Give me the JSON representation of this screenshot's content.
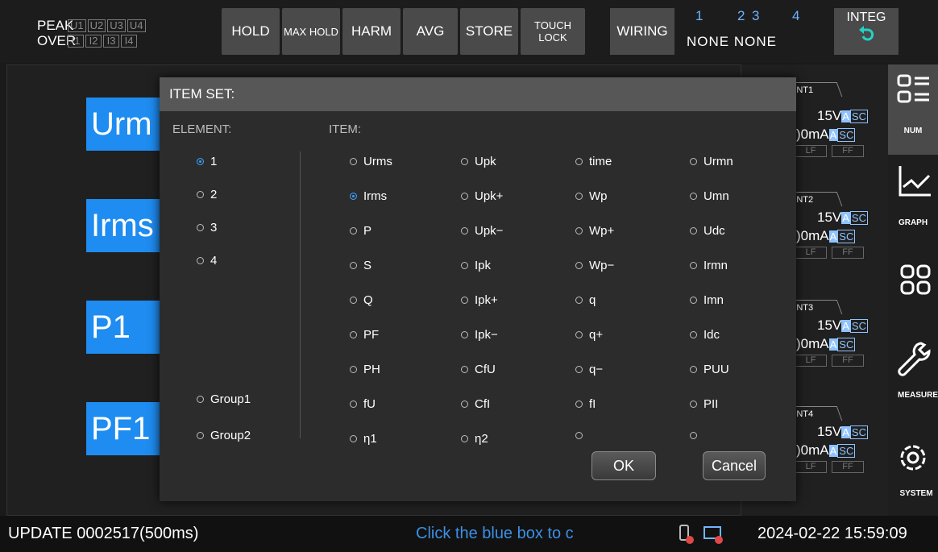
{
  "topbar": {
    "peak_label": "PEAK",
    "over_label": "OVER",
    "peak_chips": [
      "U1",
      "U2",
      "U3",
      "U4"
    ],
    "over_chips": [
      "I1",
      "I2",
      "I3",
      "I4"
    ],
    "hold": "HOLD",
    "max_hold": "MAX HOLD",
    "harm": "HARM",
    "avg": "AVG",
    "store": "STORE",
    "touch_lock": "TOUCH LOCK",
    "wiring": "WIRING",
    "wiring_nums": [
      "1",
      "2",
      "3",
      "4"
    ],
    "wiring_vals": "NONE NONE",
    "integ": "INTEG",
    "integ_icon": "reset-arrow-icon"
  },
  "main": {
    "boxes": [
      "Urm",
      "Irms",
      "P1",
      "PF1"
    ]
  },
  "elements": [
    {
      "tab": "NT1",
      "range_v": "15V",
      "range_i": ")0mA",
      "lf": "LF",
      "ff": "FF",
      "a": "A",
      "sc": "SC"
    },
    {
      "tab": "NT2",
      "range_v": "15V",
      "range_i": ")0mA",
      "lf": "LF",
      "ff": "FF",
      "a": "A",
      "sc": "SC"
    },
    {
      "tab": "NT3",
      "range_v": "15V",
      "range_i": ")0mA",
      "lf": "LF",
      "ff": "FF",
      "a": "A",
      "sc": "SC"
    },
    {
      "tab": "NT4",
      "range_v": "15V",
      "range_i": ")0mA",
      "lf": "LF",
      "ff": "FF",
      "a": "A",
      "sc": "SC"
    }
  ],
  "sidebar": [
    {
      "label": "NUM",
      "icon": "list-icon",
      "active": true
    },
    {
      "label": "GRAPH",
      "icon": "graph-icon"
    },
    {
      "label": "",
      "icon": "grid-icon"
    },
    {
      "label": "MEASURE",
      "icon": "wrench-icon"
    },
    {
      "label": "SYSTEM",
      "icon": "gear-icon"
    }
  ],
  "dialog": {
    "title": "ITEM SET:",
    "element_label": "ELEMENT:",
    "item_label": "ITEM:",
    "elements": [
      "1",
      "2",
      "3",
      "4"
    ],
    "groups": [
      "Group1",
      "Group2"
    ],
    "selected_element": "1",
    "items": {
      "col1": [
        "Urms",
        "Irms",
        "P",
        "S",
        "Q",
        "PF",
        "PH",
        "fU",
        "η1"
      ],
      "col2": [
        "Upk",
        "Upk+",
        "Upk−",
        "Ipk",
        "Ipk+",
        "Ipk−",
        "CfU",
        "CfI",
        "η2"
      ],
      "col3": [
        "time",
        "Wp",
        "Wp+",
        "Wp−",
        "q",
        "q+",
        "q−",
        "fI",
        ""
      ],
      "col4": [
        "Urmn",
        "Umn",
        "Udc",
        "Irmn",
        "Imn",
        "Idc",
        "PUU",
        "PII",
        ""
      ]
    },
    "selected_item": "Irms",
    "ok": "OK",
    "cancel": "Cancel"
  },
  "status": {
    "update": "UPDATE 0002517(500ms)",
    "hint": "Click the blue box to c",
    "datetime": "2024-02-22 15:59:09",
    "colors": {
      "hint": "#3d8fe6"
    }
  }
}
